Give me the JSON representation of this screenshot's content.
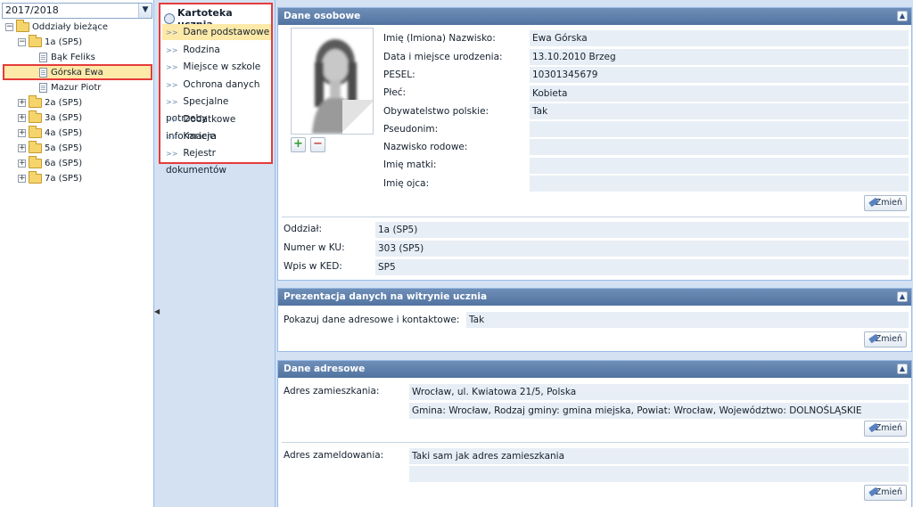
{
  "year_select": {
    "value": "2017/2018"
  },
  "tree": {
    "root": "Oddziały bieżące",
    "class_open": "1a (SP5)",
    "students": [
      "Bąk Feliks",
      "Górska Ewa",
      "Mazur Piotr"
    ],
    "classes": [
      "2a (SP5)",
      "3a (SP5)",
      "4a (SP5)",
      "5a (SP5)",
      "6a (SP5)",
      "7a (SP5)"
    ]
  },
  "menu": {
    "title": "Kartoteka ucznia",
    "items": [
      "Dane podstawowe",
      "Rodzina",
      "Miejsce w szkole",
      "Ochrona danych",
      "Specjalne potrzeby",
      "Dodatkowe informacje",
      "Kariera",
      "Rejestr dokumentów"
    ],
    "active_index": 0
  },
  "personal": {
    "header": "Dane osobowe",
    "fields": [
      {
        "label": "Imię (Imiona) Nazwisko:",
        "value": "Ewa Górska"
      },
      {
        "label": "Data i miejsce urodzenia:",
        "value": "13.10.2010 Brzeg"
      },
      {
        "label": "PESEL:",
        "value": "10301345679"
      },
      {
        "label": "Płeć:",
        "value": "Kobieta"
      },
      {
        "label": "Obywatelstwo polskie:",
        "value": "Tak"
      },
      {
        "label": "Pseudonim:",
        "value": ""
      },
      {
        "label": "Nazwisko rodowe:",
        "value": ""
      },
      {
        "label": "Imię matki:",
        "value": ""
      },
      {
        "label": "Imię ojca:",
        "value": ""
      }
    ],
    "class_fields": [
      {
        "label": "Oddział:",
        "value": "1a (SP5)"
      },
      {
        "label": "Numer w KU:",
        "value": "303 (SP5)"
      },
      {
        "label": "Wpis w KED:",
        "value": "SP5"
      }
    ],
    "edit_label": "Zmień"
  },
  "presentation": {
    "header": "Prezentacja danych na witrynie ucznia",
    "label": "Pokazuj dane adresowe i kontaktowe:",
    "value": "Tak",
    "edit_label": "Zmień"
  },
  "address": {
    "header": "Dane adresowe",
    "residence_label": "Adres zamieszkania:",
    "residence_line1": "Wrocław, ul. Kwiatowa 21/5, Polska",
    "residence_line2": "Gmina: Wrocław, Rodzaj gminy: gmina miejska, Powiat: Wrocław, Województwo: DOLNOŚLĄSKIE",
    "registered_label": "Adres zameldowania:",
    "registered_line1": "Taki sam jak adres zamieszkania",
    "registered_line2": "",
    "edit_label": "Zmień"
  },
  "icons": {
    "expand": "plus-box",
    "collapse": "minus-box",
    "toggle": "double-chevron-up"
  }
}
